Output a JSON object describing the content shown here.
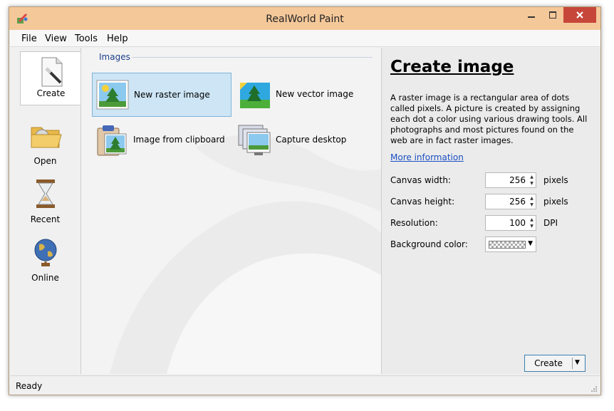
{
  "window": {
    "title": "RealWorld Paint"
  },
  "titlebar": {
    "minimize_icon": "minimize-icon",
    "maximize_icon": "maximize-icon",
    "close_icon": "close-icon"
  },
  "menu": [
    "File",
    "View",
    "Tools",
    "Help"
  ],
  "nav": [
    {
      "label": "Create",
      "icon": "create-document-icon",
      "active": true
    },
    {
      "label": "Open",
      "icon": "open-folder-icon"
    },
    {
      "label": "Recent",
      "icon": "hourglass-icon"
    },
    {
      "label": "Online",
      "icon": "globe-icon"
    }
  ],
  "center": {
    "group_label": "Images",
    "items": [
      {
        "label": "New raster image",
        "icon": "raster-image-icon",
        "selected": true
      },
      {
        "label": "New vector image",
        "icon": "vector-image-icon"
      },
      {
        "label": "Image from clipboard",
        "icon": "clipboard-image-icon"
      },
      {
        "label": "Capture desktop",
        "icon": "capture-desktop-icon"
      }
    ]
  },
  "right": {
    "title": "Create image",
    "description": "A raster image is a rectangular area of dots called pixels. A picture is created by assigning each dot a color using various drawing tools. All photographs and most pictures found on the web are in fact raster images.",
    "more_link": "More information",
    "fields": [
      {
        "label": "Canvas width:",
        "value": "256",
        "unit": "pixels"
      },
      {
        "label": "Canvas height:",
        "value": "256",
        "unit": "pixels"
      },
      {
        "label": "Resolution:",
        "value": "100",
        "unit": "DPI"
      }
    ],
    "background_label": "Background color:",
    "background_value": "transparent",
    "create_button": "Create"
  },
  "status": {
    "text": "Ready"
  },
  "colors": {
    "titlebar": "#f5c89a",
    "close": "#c7463a",
    "link": "#1a4fc4",
    "selected_tile": "#cde5f5"
  }
}
